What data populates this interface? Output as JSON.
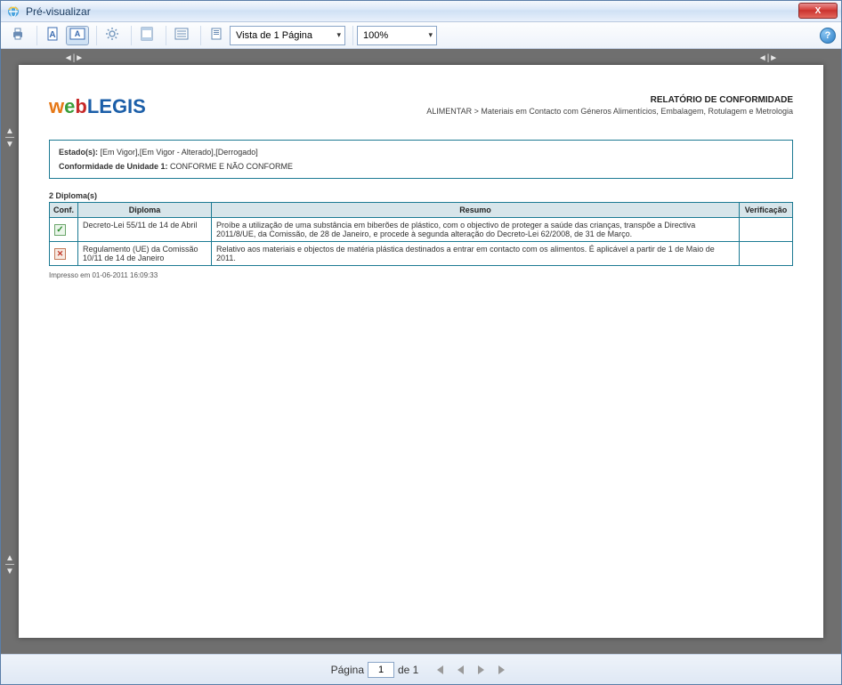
{
  "window": {
    "title": "Pré-visualizar",
    "close_glyph": "X"
  },
  "toolbar": {
    "view_mode": "Vista de 1 Página",
    "zoom": "100%",
    "help_glyph": "?"
  },
  "doc": {
    "report_title": "RELATÓRIO DE CONFORMIDADE",
    "breadcrumb": "ALIMENTAR > Materiais em Contacto com Géneros Alimentícios, Embalagem, Rotulagem e Metrologia",
    "filter_estado_label": "Estado(s):",
    "filter_estado_value": "[Em Vigor],[Em Vigor - Alterado],[Derrogado]",
    "filter_conf_label": "Conformidade de Unidade 1:",
    "filter_conf_value": "CONFORME E NÃO CONFORME",
    "count": "2 Diploma(s)",
    "columns": {
      "conf": "Conf.",
      "diploma": "Diploma",
      "resumo": "Resumo",
      "verificacao": "Verificação"
    },
    "rows": [
      {
        "conf": "ok",
        "diploma": "Decreto-Lei 55/11 de 14 de Abril",
        "resumo": "Proíbe a utilização de uma substância em biberões de plástico, com o objectivo de proteger a saúde das crianças, transpõe a Directiva 2011/8/UE, da Comissão, de 28 de Janeiro, e procede à segunda alteração do Decreto-Lei 62/2008, de 31 de Março.",
        "verificacao": ""
      },
      {
        "conf": "no",
        "diploma": "Regulamento (UE) da Comissão 10/11 de 14 de Janeiro",
        "resumo": "Relativo aos materiais e objectos de matéria plástica destinados a entrar em contacto com os alimentos. É aplicável a partir de 1 de Maio de 2011.",
        "verificacao": ""
      }
    ],
    "printed": "Impresso em 01-06-2011 16:09:33"
  },
  "footer": {
    "page_label_prefix": "Página",
    "page_current": "1",
    "page_label_suffix": "de 1"
  }
}
